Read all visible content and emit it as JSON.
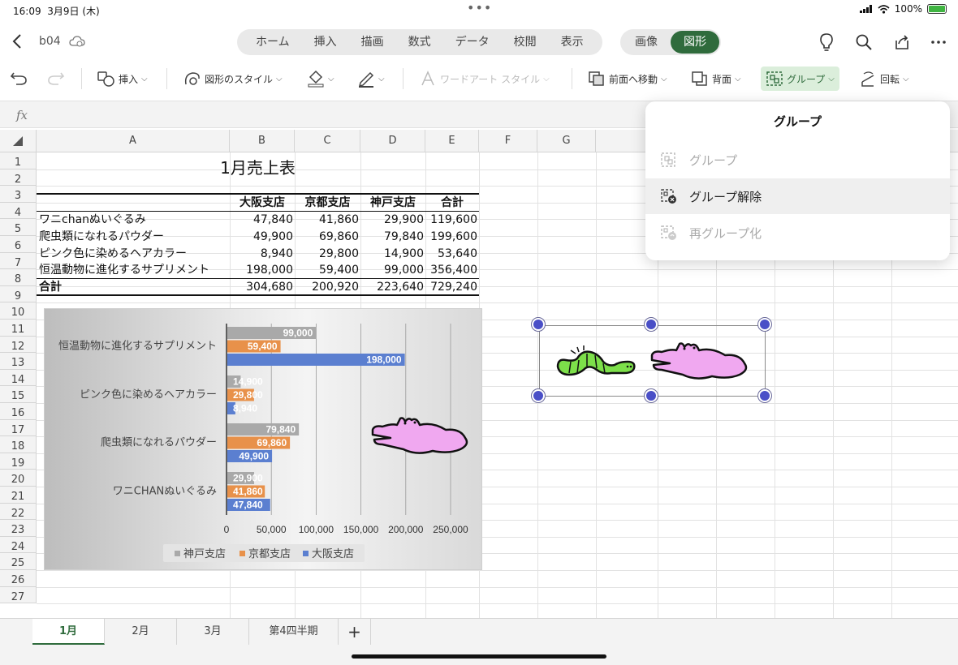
{
  "status": {
    "time": "16:09",
    "date": "3月9日 (木)",
    "battery": "100%"
  },
  "title": {
    "file_name": "b04"
  },
  "menu_tabs": [
    "ホーム",
    "挿入",
    "描画",
    "数式",
    "データ",
    "校閲",
    "表示"
  ],
  "context_tabs": [
    "画像",
    "図形"
  ],
  "active_tab": "図形",
  "ribbon": {
    "insert": "挿入",
    "shape_style": "図形のスタイル",
    "wordart": "ワードアート スタイル",
    "bring_forward": "前面へ移動",
    "send_backward": "背面",
    "group": "グループ",
    "rotate": "回転"
  },
  "formula_bar": {
    "fx": "fx"
  },
  "columns": [
    "A",
    "B",
    "C",
    "D",
    "E",
    "F",
    "G"
  ],
  "rows": [
    "1",
    "2",
    "3",
    "4",
    "5",
    "6",
    "7",
    "8",
    "9",
    "10",
    "11",
    "12",
    "13",
    "14",
    "15",
    "16",
    "17",
    "18",
    "19",
    "20",
    "21",
    "22",
    "23",
    "24",
    "25",
    "26",
    "27"
  ],
  "table": {
    "title": "1月売上表",
    "headers": [
      "大阪支店",
      "京都支店",
      "神戸支店",
      "合計"
    ],
    "rows": [
      {
        "name": "ワニchanぬいぐるみ",
        "values": [
          "47,840",
          "41,860",
          "29,900",
          "119,600"
        ]
      },
      {
        "name": "爬虫類になれるパウダー",
        "values": [
          "49,900",
          "69,860",
          "79,840",
          "199,600"
        ]
      },
      {
        "name": "ピンク色に染めるヘアカラー",
        "values": [
          "8,940",
          "29,800",
          "14,900",
          "53,640"
        ]
      },
      {
        "name": "恒温動物に進化するサプリメント",
        "values": [
          "198,000",
          "59,400",
          "99,000",
          "356,400"
        ]
      }
    ],
    "total": {
      "name": "合計",
      "values": [
        "304,680",
        "200,920",
        "223,640",
        "729,240"
      ]
    }
  },
  "chart_data": {
    "type": "bar",
    "orientation": "horizontal",
    "categories": [
      "恒温動物に進化するサプリメント",
      "ピンク色に染めるヘアカラー",
      "爬虫類になれるパウダー",
      "ワニCHANぬいぐるみ"
    ],
    "series": [
      {
        "name": "神戸支店",
        "color": "#a9a9a9",
        "values": [
          99000,
          14900,
          79840,
          29900
        ],
        "labels": [
          "99,000",
          "14,900",
          "79,840",
          "29,900"
        ]
      },
      {
        "name": "京都支店",
        "color": "#e8914a",
        "values": [
          59400,
          29800,
          69860,
          41860
        ],
        "labels": [
          "59,400",
          "29,800",
          "69,860",
          "41,860"
        ]
      },
      {
        "name": "大阪支店",
        "color": "#5b7fd0",
        "values": [
          198000,
          8940,
          49900,
          47840
        ],
        "labels": [
          "198,000",
          "8,940",
          "49,900",
          "47,840"
        ]
      }
    ],
    "xticks": [
      "0",
      "50,000",
      "100,000",
      "150,000",
      "200,000",
      "250,000"
    ],
    "xlim": [
      0,
      250000
    ],
    "grid": true,
    "legend": "bottom"
  },
  "dropdown": {
    "title": "グループ",
    "items": [
      {
        "label": "グループ",
        "enabled": false
      },
      {
        "label": "グループ解除",
        "enabled": true
      },
      {
        "label": "再グループ化",
        "enabled": false
      }
    ]
  },
  "sheets": [
    "1月",
    "2月",
    "3月",
    "第4四半期"
  ],
  "add_sheet": "+"
}
